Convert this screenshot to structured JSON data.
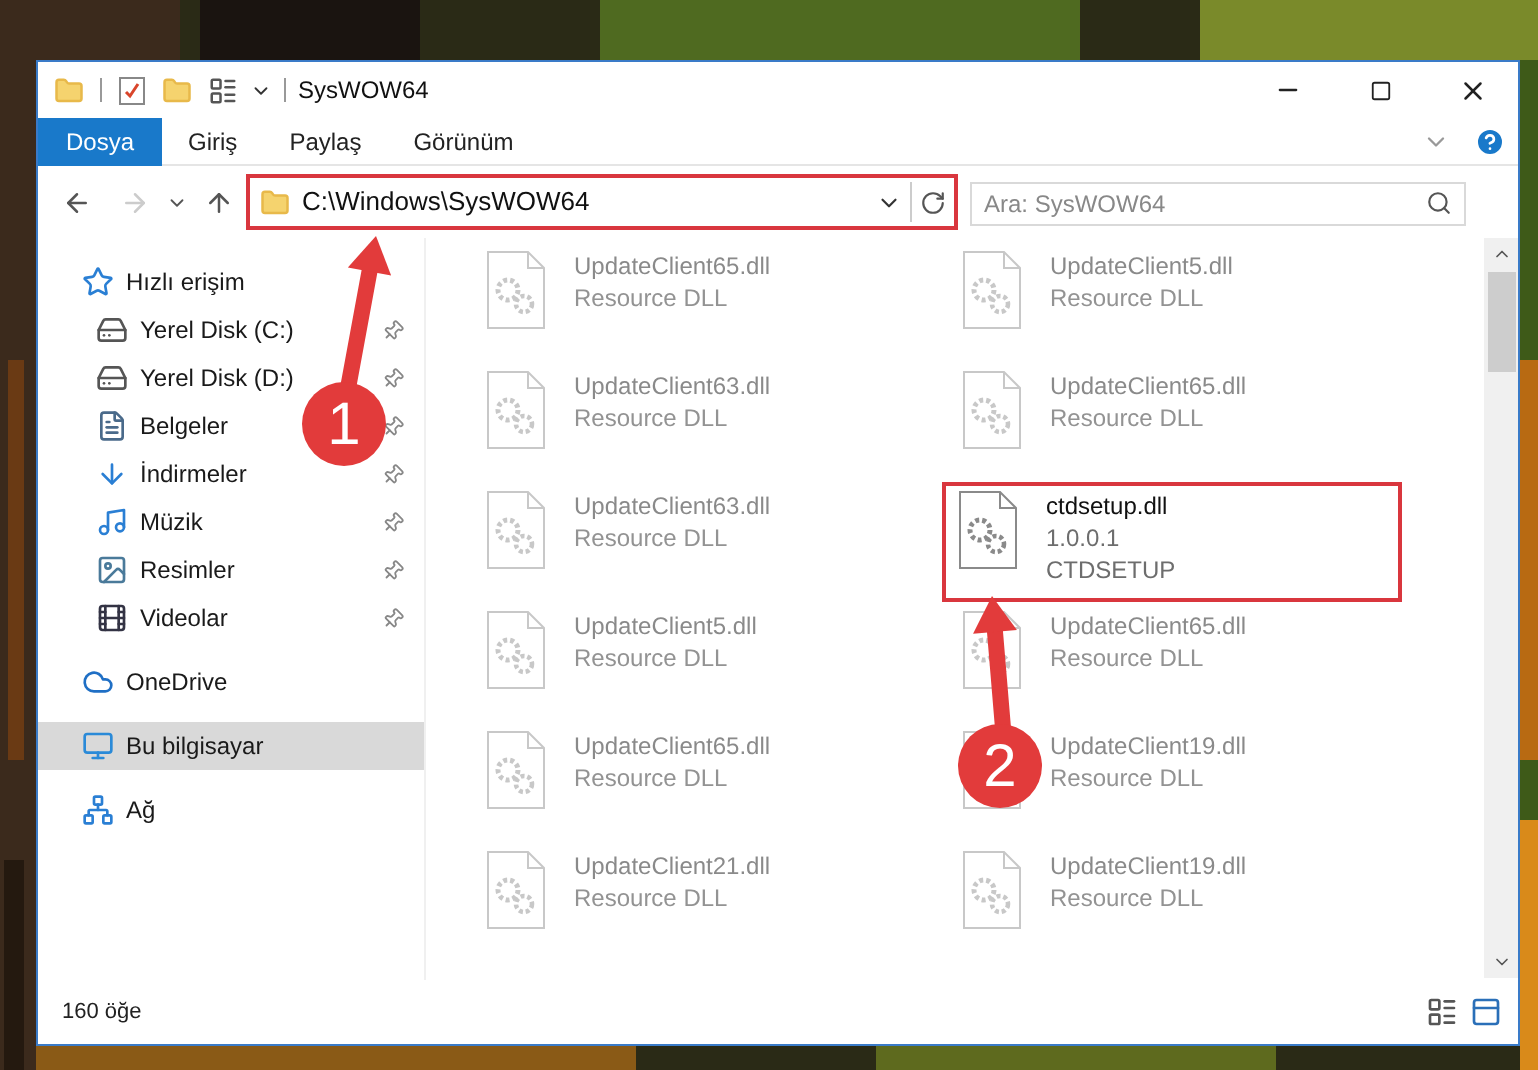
{
  "window": {
    "title": "SysWOW64"
  },
  "ribbon_tabs": [
    {
      "label": "Dosya",
      "kind": "file"
    },
    {
      "label": "Giriş",
      "kind": "tab"
    },
    {
      "label": "Paylaş",
      "kind": "tab"
    },
    {
      "label": "Görünüm",
      "kind": "tab"
    }
  ],
  "address": {
    "path": "C:\\Windows\\SysWOW64",
    "highlighted": true
  },
  "search": {
    "placeholder": "Ara: SysWOW64"
  },
  "sidebar": {
    "items": [
      {
        "label": "Hızlı erişim",
        "kind": "star",
        "selected": false,
        "children": [
          {
            "label": "Yerel Disk (C:)",
            "kind": "drive",
            "pinned": true,
            "selected": false
          },
          {
            "label": "Yerel Disk (D:)",
            "kind": "drive",
            "pinned": true,
            "selected": false
          },
          {
            "label": "Belgeler",
            "kind": "documents",
            "pinned": true,
            "selected": false
          },
          {
            "label": "İndirmeler",
            "kind": "downloads",
            "pinned": true,
            "selected": false
          },
          {
            "label": "Müzik",
            "kind": "music",
            "pinned": true,
            "selected": false
          },
          {
            "label": "Resimler",
            "kind": "pictures",
            "pinned": true,
            "selected": false
          },
          {
            "label": "Videolar",
            "kind": "videos",
            "pinned": true,
            "selected": false
          }
        ]
      },
      {
        "label": "OneDrive",
        "kind": "cloud",
        "selected": false
      },
      {
        "label": "Bu bilgisayar",
        "kind": "computer",
        "selected": true
      },
      {
        "label": "Ağ",
        "kind": "network",
        "selected": false
      }
    ]
  },
  "files": [
    {
      "name": "UpdateClient65.dll",
      "details": [
        "Resource DLL"
      ],
      "faded": true,
      "highlighted": false
    },
    {
      "name": "UpdateClient5.dll",
      "details": [
        "Resource DLL"
      ],
      "faded": true,
      "highlighted": false
    },
    {
      "name": "UpdateClient63.dll",
      "details": [
        "Resource DLL"
      ],
      "faded": true,
      "highlighted": false
    },
    {
      "name": "UpdateClient65.dll",
      "details": [
        "Resource DLL"
      ],
      "faded": true,
      "highlighted": false
    },
    {
      "name": "UpdateClient63.dll",
      "details": [
        "Resource DLL"
      ],
      "faded": true,
      "highlighted": false
    },
    {
      "name": "ctdsetup.dll",
      "details": [
        "1.0.0.1",
        "CTDSETUP"
      ],
      "faded": false,
      "highlighted": true
    },
    {
      "name": "UpdateClient5.dll",
      "details": [
        "Resource DLL"
      ],
      "faded": true,
      "highlighted": false
    },
    {
      "name": "UpdateClient65.dll",
      "details": [
        "Resource DLL"
      ],
      "faded": true,
      "highlighted": false
    },
    {
      "name": "UpdateClient65.dll",
      "details": [
        "Resource DLL"
      ],
      "faded": true,
      "highlighted": false
    },
    {
      "name": "UpdateClient19.dll",
      "details": [
        "Resource DLL"
      ],
      "faded": true,
      "highlighted": false
    },
    {
      "name": "UpdateClient21.dll",
      "details": [
        "Resource DLL"
      ],
      "faded": true,
      "highlighted": false
    },
    {
      "name": "UpdateClient19.dll",
      "details": [
        "Resource DLL"
      ],
      "faded": true,
      "highlighted": false
    }
  ],
  "status_bar": {
    "count": "160 öğe"
  },
  "annotations": [
    {
      "number": "1"
    },
    {
      "number": "2"
    }
  ]
}
